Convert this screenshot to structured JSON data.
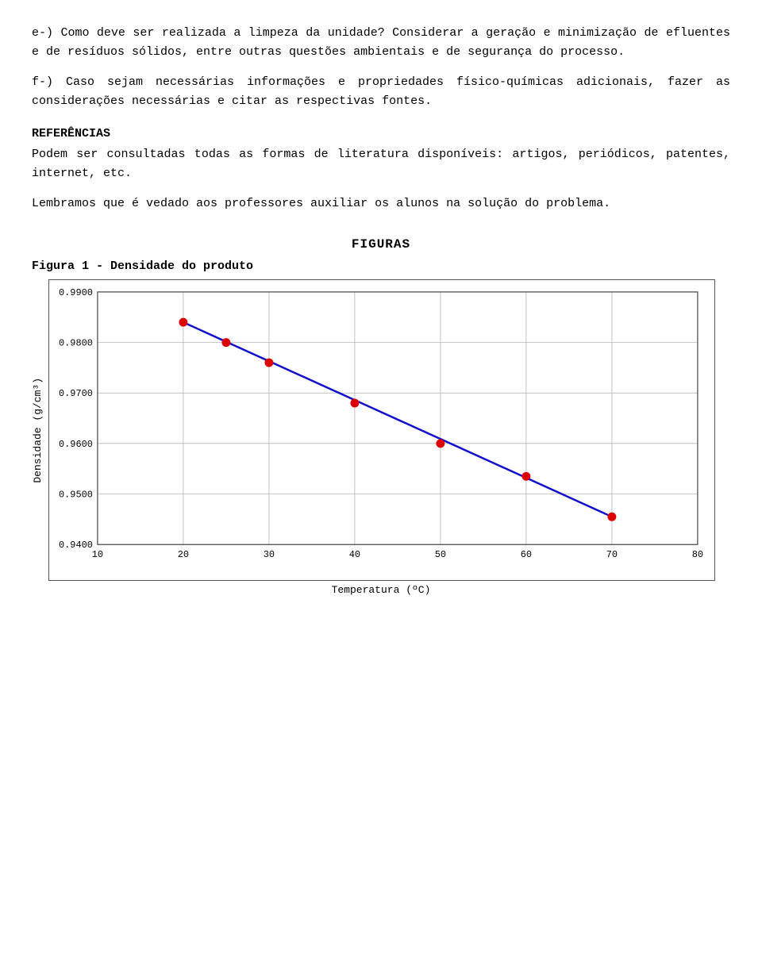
{
  "paragraphs": [
    "e-) Como deve ser realizada a limpeza da unidade? Considerar a geração e minimização de efluentes e de resíduos sólidos, entre outras questões ambientais e de segurança do processo.",
    "f-) Caso sejam necessárias informações e propriedades físico-químicas adicionais, fazer as considerações necessárias e citar as respectivas fontes."
  ],
  "references_heading": "REFERÊNCIAS",
  "references_text": "Podem ser consultadas todas as formas de literatura disponíveis: artigos, periódicos, patentes, internet, etc.",
  "warning_text": "Lembramos que é vedado aos professores auxiliar os alunos na solução do problema.",
  "figures_heading": "FIGURAS",
  "figure1_title": "Figura 1",
  "figure1_subtitle": " - Densidade do produto",
  "y_axis_label": "Densidade (g/cm³)",
  "x_axis_label": "Temperatura (ºC)",
  "chart": {
    "x_min": 10,
    "x_max": 80,
    "y_min": 0.94,
    "y_max": 0.99,
    "x_ticks": [
      10,
      20,
      30,
      40,
      50,
      60,
      70,
      80
    ],
    "y_ticks": [
      0.94,
      0.95,
      0.96,
      0.97,
      0.98,
      0.99
    ],
    "data_points": [
      {
        "x": 20,
        "y": 0.984
      },
      {
        "x": 25,
        "y": 0.98
      },
      {
        "x": 30,
        "y": 0.976
      },
      {
        "x": 40,
        "y": 0.968
      },
      {
        "x": 50,
        "y": 0.96
      },
      {
        "x": 60,
        "y": 0.9535
      },
      {
        "x": 70,
        "y": 0.9455
      }
    ]
  }
}
